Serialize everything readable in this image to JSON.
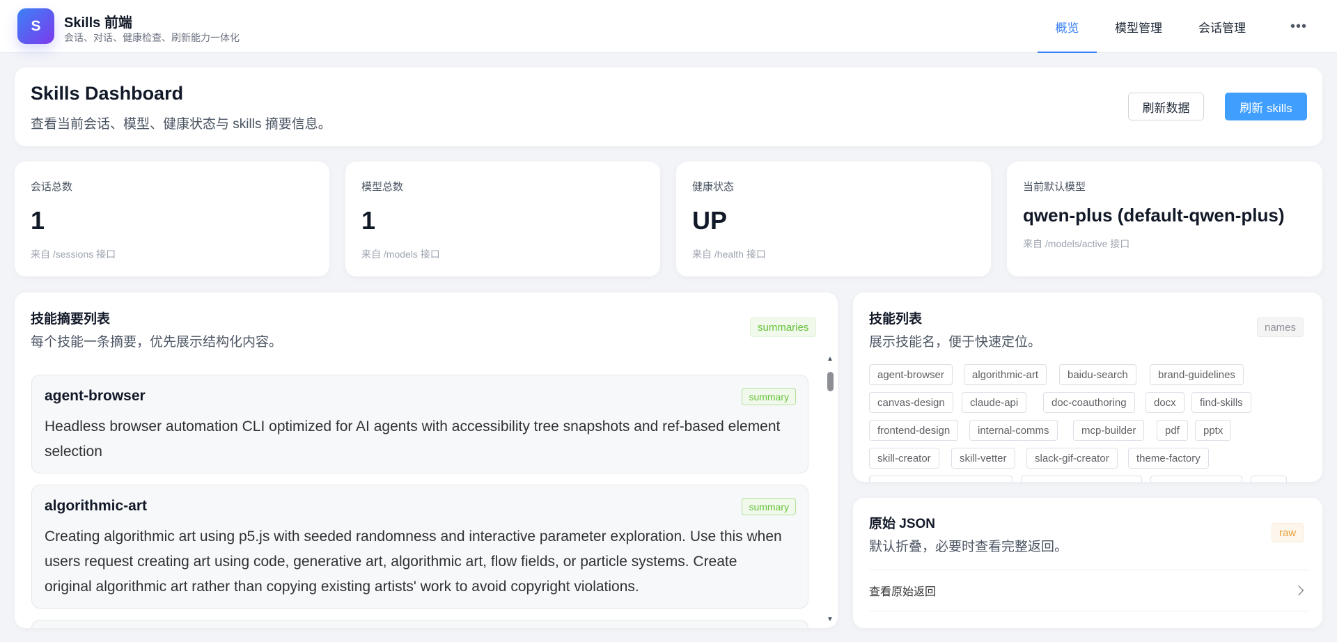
{
  "header": {
    "logo_letter": "S",
    "app_title": "Skills 前端",
    "app_subtitle": "会话、对话、健康检查、刷新能力一体化",
    "nav": [
      {
        "label": "概览",
        "active": true
      },
      {
        "label": "模型管理",
        "active": false
      },
      {
        "label": "会话管理",
        "active": false
      }
    ],
    "more_label": "•••"
  },
  "dashboard": {
    "title": "Skills Dashboard",
    "description": "查看当前会话、模型、健康状态与 skills 摘要信息。",
    "refresh_data_label": "刷新数据",
    "refresh_skills_label": "刷新 skills"
  },
  "stats": [
    {
      "label": "会话总数",
      "value": "1",
      "note": "来自 /sessions 接口"
    },
    {
      "label": "模型总数",
      "value": "1",
      "note": "来自 /models 接口"
    },
    {
      "label": "健康状态",
      "value": "UP",
      "note": "来自 /health 接口"
    },
    {
      "label": "当前默认模型",
      "value": "qwen-plus (default-qwen-plus)",
      "note": "来自 /models/active 接口"
    }
  ],
  "summaries": {
    "title": "技能摘要列表",
    "description": "每个技能一条摘要，优先展示结构化内容。",
    "tag": "summaries",
    "items": [
      {
        "name": "agent-browser",
        "badge": "summary",
        "text": "Headless browser automation CLI optimized for AI agents with accessibility tree snapshots and ref-based element selection"
      },
      {
        "name": "algorithmic-art",
        "badge": "summary",
        "text": "Creating algorithmic art using p5.js with seeded randomness and interactive parameter exploration. Use this when users request creating art using code, generative art, algorithmic art, flow fields, or particle systems. Create original algorithmic art rather than copying existing artists' work to avoid copyright violations."
      }
    ]
  },
  "skill_names": {
    "title": "技能列表",
    "description": "展示技能名，便于快速定位。",
    "tag": "names",
    "names": [
      "agent-browser",
      "algorithmic-art",
      "baidu-search",
      "brand-guidelines",
      "canvas-design",
      "claude-api",
      "doc-coauthoring",
      "docx",
      "find-skills",
      "frontend-design",
      "internal-comms",
      "mcp-builder",
      "pdf",
      "pptx",
      "skill-creator",
      "skill-vetter",
      "slack-gif-creator",
      "theme-factory"
    ]
  },
  "raw_json": {
    "title": "原始 JSON",
    "description": "默认折叠，必要时查看完整返回。",
    "tag": "raw",
    "collapse_label": "查看原始返回"
  },
  "colors": {
    "primary": "#409eff",
    "accent_gradient_start": "#3b82f6",
    "accent_gradient_end": "#7c3aed",
    "success_text": "#67c23a",
    "warning_text": "#e6a23c"
  }
}
